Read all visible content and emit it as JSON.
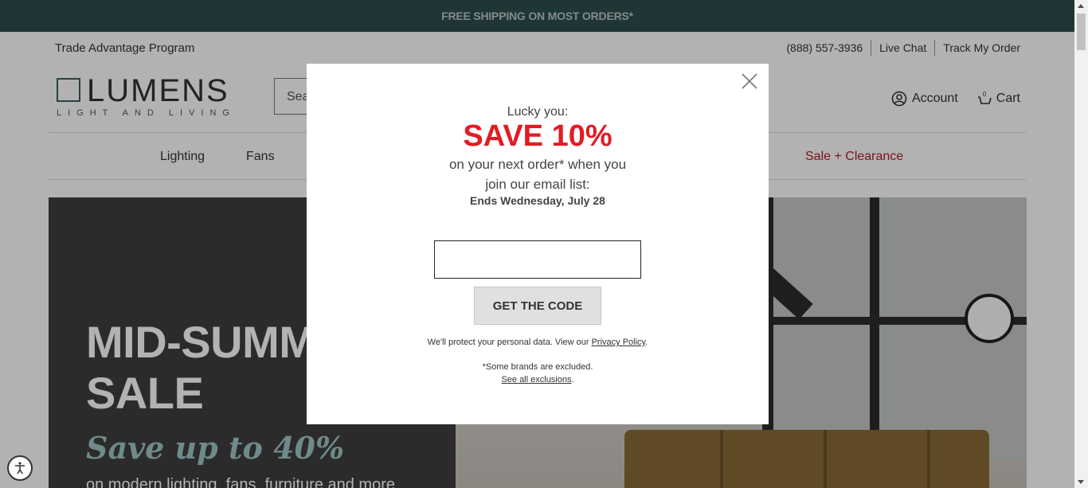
{
  "promo_bar": {
    "text": "FREE SHIPPING ON MOST ORDERS*"
  },
  "utility": {
    "trade_link": "Trade Advantage Program",
    "phone": "(888) 557-3936",
    "live_chat": "Live Chat",
    "track_order": "Track My Order"
  },
  "header": {
    "logo_name": "LUMENS",
    "logo_tagline": "LIGHT AND LIVING",
    "search_placeholder": "Sea",
    "account_label": "Account",
    "cart_label": "Cart",
    "cart_count": "0"
  },
  "nav": {
    "items": [
      "Lighting",
      "Fans",
      "Sale + Clearance"
    ],
    "sale_color": "#b01e23"
  },
  "hero": {
    "title_line1": "MID-SUMM",
    "title_line2": "SALE",
    "subtitle": "Save up to 40%",
    "description": "on modern lighting, fans, furniture and more"
  },
  "modal": {
    "intro": "Lucky you:",
    "headline": "SAVE 10%",
    "line1": "on your next order* when you",
    "line2": "join our email list:",
    "ends": "Ends Wednesday, July 28",
    "email_value": "",
    "button_label": "GET THE CODE",
    "privacy_text": "We'll protect your personal data. View our ",
    "privacy_link": "Privacy Policy",
    "privacy_end": ".",
    "exclusion_note": "*Some brands are excluded.",
    "exclusion_link": "See all exclusions",
    "exclusion_end": ".",
    "accent_color": "#e31b23"
  },
  "icons": {
    "close": "close-icon",
    "account": "user-circle-icon",
    "cart": "cart-icon",
    "accessibility": "accessibility-icon"
  }
}
